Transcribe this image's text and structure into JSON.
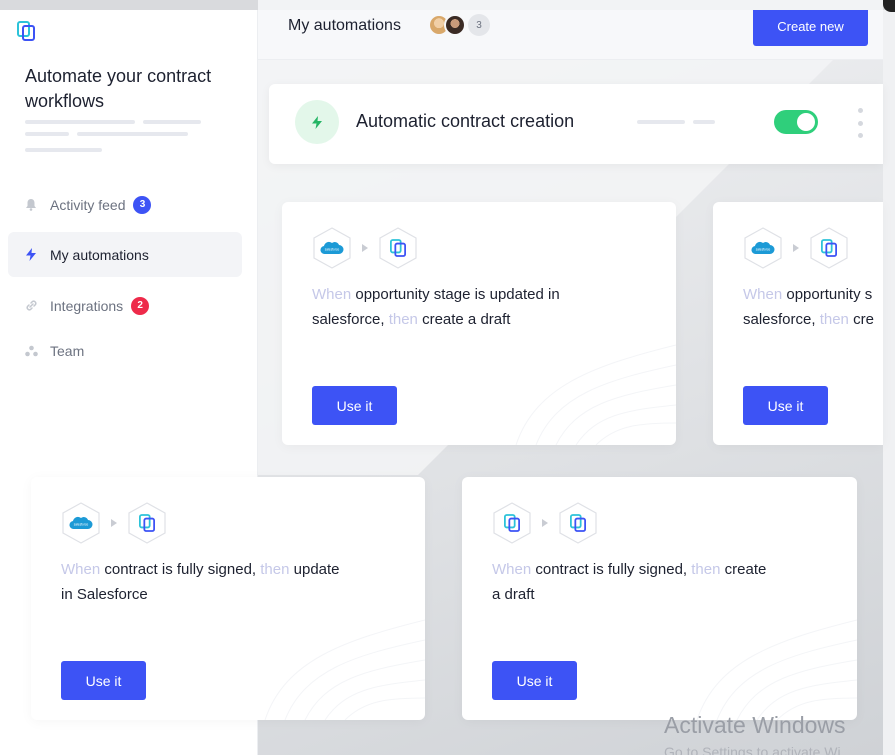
{
  "sidebar": {
    "tagline": "Automate your contract workflows",
    "nav": [
      {
        "label": "Activity feed",
        "badge": "3",
        "badge_color": "#3d53f5"
      },
      {
        "label": "My automations",
        "badge": ""
      },
      {
        "label": "Integrations",
        "badge": "2",
        "badge_color": "#ee2a4a"
      },
      {
        "label": "Team",
        "badge": ""
      }
    ]
  },
  "header": {
    "title": "My automations",
    "avatar_count": "3",
    "create_label": "Create new"
  },
  "automation": {
    "title": "Automatic contract creation",
    "enabled": true
  },
  "cards": [
    {
      "kw1": "When",
      "t1": " opportunity stage is updated in",
      "t2": "salesforce, ",
      "kw2": "then",
      "t3": " create a draft",
      "button": "Use it",
      "from_icon": "salesforce-icon",
      "to_icon": "contract-app-icon"
    },
    {
      "kw1": "When",
      "t1": " opportunity s",
      "t2": "salesforce, ",
      "kw2": "then",
      "t3": " cre",
      "button": "Use it",
      "from_icon": "salesforce-icon",
      "to_icon": "contract-app-icon"
    },
    {
      "kw1": "When",
      "t1": " contract is fully signed, ",
      "kw_mid": "then",
      "t_mid": " update",
      "t2": "in Salesforce",
      "button": "Use it",
      "from_icon": "salesforce-icon",
      "to_icon": "contract-app-icon"
    },
    {
      "kw1": "When",
      "t1": " contract is fully signed, ",
      "kw_mid": "then",
      "t_mid": " create",
      "t2": "a draft",
      "button": "Use it",
      "from_icon": "contract-app-icon",
      "to_icon": "contract-app-icon"
    }
  ],
  "salesforce_label": "salesforce",
  "watermark": {
    "title": "Activate Windows",
    "sub": "Go to Settings to activate Wi"
  },
  "colors": {
    "primary": "#3d53f5",
    "toggle_on": "#2fcf7b",
    "keyword": "#c5c8e8"
  }
}
